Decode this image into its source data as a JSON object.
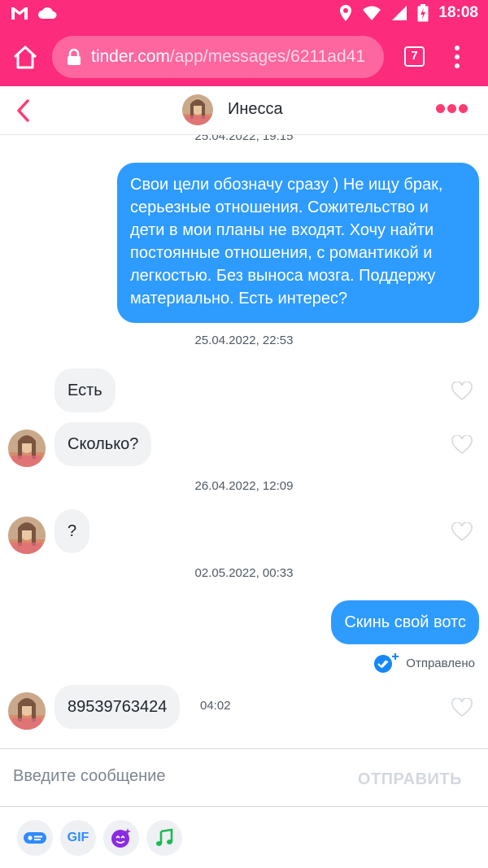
{
  "status_bar": {
    "time": "18:08",
    "icons": [
      "gmail-icon",
      "cloud-icon",
      "location-icon",
      "wifi-icon",
      "signal-icon",
      "battery-charging-icon"
    ]
  },
  "browser": {
    "url_host": "tinder.com",
    "url_path": "/app/messages/6211ad41",
    "tab_count": "7"
  },
  "header": {
    "name": "Инесса"
  },
  "messages": {
    "top_timestamp": "25.04.2022, 19:15",
    "outgoing_1": "Свои цели обозначу сразу ) Не ищу брак, серьезные отношения. Сожительство и дети в мои планы не входят. Хочу найти постоянные отношения, с романтикой и легкостью. Без выноса мозга. Поддержу материально. Есть интерес?",
    "timestamp_2": "25.04.2022, 22:53",
    "incoming_1": "Есть",
    "incoming_2": "Сколько?",
    "timestamp_3": "26.04.2022, 12:09",
    "incoming_3": "?",
    "timestamp_4": "02.05.2022, 00:33",
    "outgoing_2": "Скинь свой вотс",
    "sent_status": "Отправлено",
    "incoming_4": "89539763424",
    "incoming_4_time": "04:02"
  },
  "composer": {
    "placeholder": "Введите сообщение",
    "send_label": "ОТПРАВИТЬ"
  },
  "toolbar": {
    "gif_label": "GIF"
  },
  "colors": {
    "brand_pink": "#fd2b7b",
    "tinder_red": "#fe3c72",
    "outgoing_bubble": "#2e9bff",
    "incoming_bubble": "#f0f2f4"
  }
}
